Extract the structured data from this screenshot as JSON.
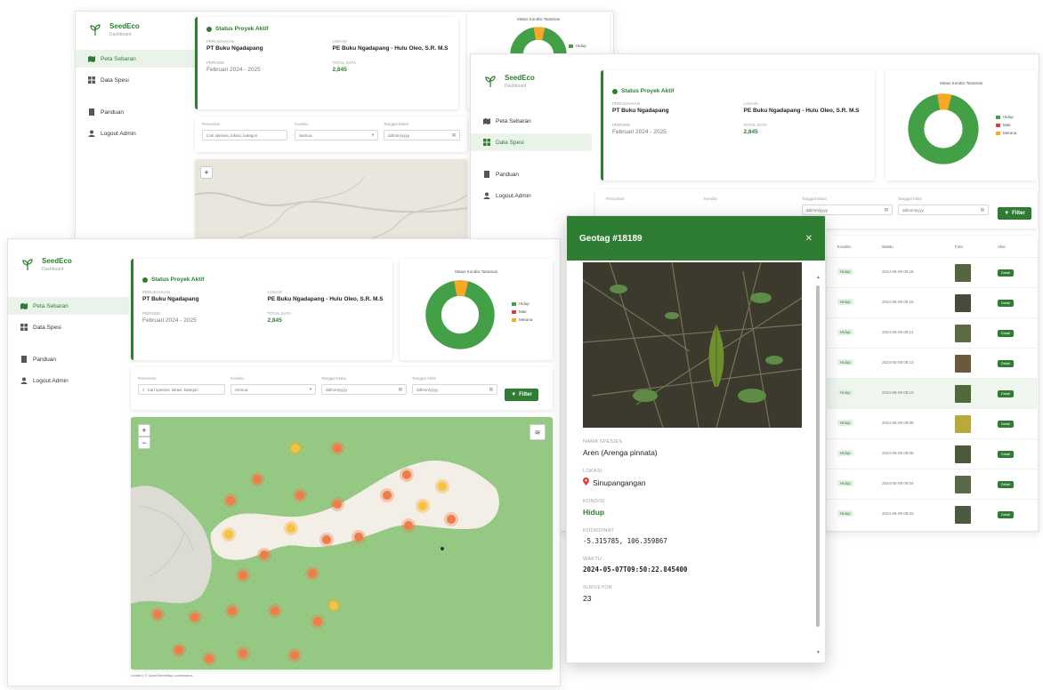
{
  "brand": {
    "name": "SeedEco",
    "tagline": "Dashboard"
  },
  "nav": {
    "peta": "Peta Sebaran",
    "data": "Data Spesi",
    "panduan": "Panduan",
    "logout": "Logout Admin"
  },
  "project": {
    "title": "Status Proyek Aktif",
    "company_label": "PERUSAHAAN",
    "company": "PT Buku Ngadapang",
    "location_label": "LOKASI",
    "location": "PE Buku Ngadapang - Hulu Oleo, S.R. M.S",
    "date_label": "PERIODE",
    "date": "Februari 2024 - 2025",
    "count_label": "TOTAL DATA",
    "count": "2,845"
  },
  "donut": {
    "title": "Status Kondisi Tanaman",
    "legend": [
      "Hidup",
      "Mati",
      "Merana"
    ]
  },
  "filter": {
    "search_label": "Pencarian",
    "search_placeholder": "Cari spesies, lokasi, kategori",
    "status_label": "Kondisi",
    "status_value": "Semua",
    "from_label": "Tanggal Mulai",
    "from_value": "dd/mm/yyyy",
    "to_label": "Tanggal Akhir",
    "to_value": "dd/mm/yyyy",
    "button": "Filter"
  },
  "table": {
    "headers": {
      "status": "Kondisi",
      "date": "Waktu",
      "photo": "Foto",
      "action": "Aksi"
    },
    "rows": [
      {
        "status": "Hidup",
        "date": "2024-05-09 09:18",
        "action": "Detail"
      },
      {
        "status": "Hidup",
        "date": "2024-05-09 09:16",
        "action": "Detail"
      },
      {
        "status": "Hidup",
        "date": "2024-05-09 09:14",
        "action": "Detail"
      },
      {
        "status": "Hidup",
        "date": "2024-05-09 09:12",
        "action": "Detail"
      },
      {
        "status": "Hidup",
        "date": "2024-05-09 09:10",
        "action": "Detail"
      },
      {
        "status": "Hidup",
        "date": "2024-05-09 09:08",
        "action": "Detail"
      },
      {
        "status": "Hidup",
        "date": "2024-05-09 09:06",
        "action": "Detail"
      },
      {
        "status": "Hidup",
        "date": "2024-05-09 09:04",
        "action": "Detail"
      },
      {
        "status": "Hidup",
        "date": "2024-05-09 09:02",
        "action": "Detail"
      }
    ]
  },
  "map": {
    "attribution": "Leaflet | © OpenStreetMap contributors"
  },
  "modal": {
    "title": "Geotag #18189",
    "species_label": "NAMA SPESIES",
    "species": "Aren (Arenga pinnata)",
    "location_label": "LOKASI",
    "location": "Sinupangangan",
    "status_label": "KONDISI",
    "status": "Hidup",
    "coords_label": "KOORDINAT",
    "coords": "-5.315785, 106.359867",
    "time_label": "WAKTU",
    "time": "2024-05-07T09:50:22.845400",
    "id_label": "SURVEYOR",
    "id": "23"
  },
  "colors": {
    "primary": "#2e7d32",
    "hidup": "#43a047",
    "mati": "#e53935",
    "merana": "#f9a825",
    "marker": "#ef7d4a"
  }
}
